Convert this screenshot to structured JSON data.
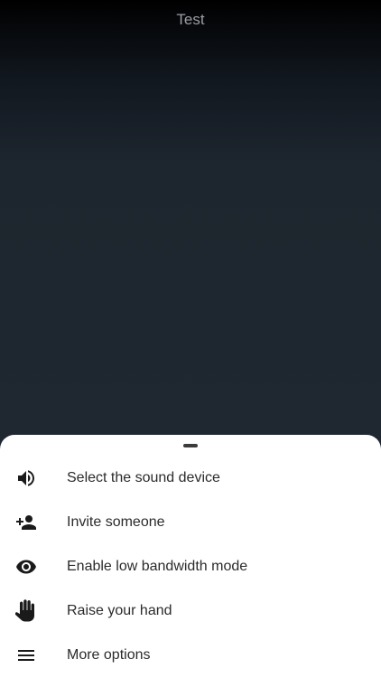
{
  "call": {
    "title": "Test"
  },
  "menu": {
    "items": [
      {
        "label": "Select the sound device",
        "icon": "speaker-icon"
      },
      {
        "label": "Invite someone",
        "icon": "add-person-icon"
      },
      {
        "label": "Enable low bandwidth mode",
        "icon": "eye-icon"
      },
      {
        "label": "Raise your hand",
        "icon": "hand-icon"
      },
      {
        "label": "More options",
        "icon": "menu-icon"
      }
    ]
  },
  "colors": {
    "background_dark": "#1f2730",
    "sheet_background": "#ffffff",
    "text_primary": "#2b2b2b",
    "title_text": "#9a9ea3"
  }
}
